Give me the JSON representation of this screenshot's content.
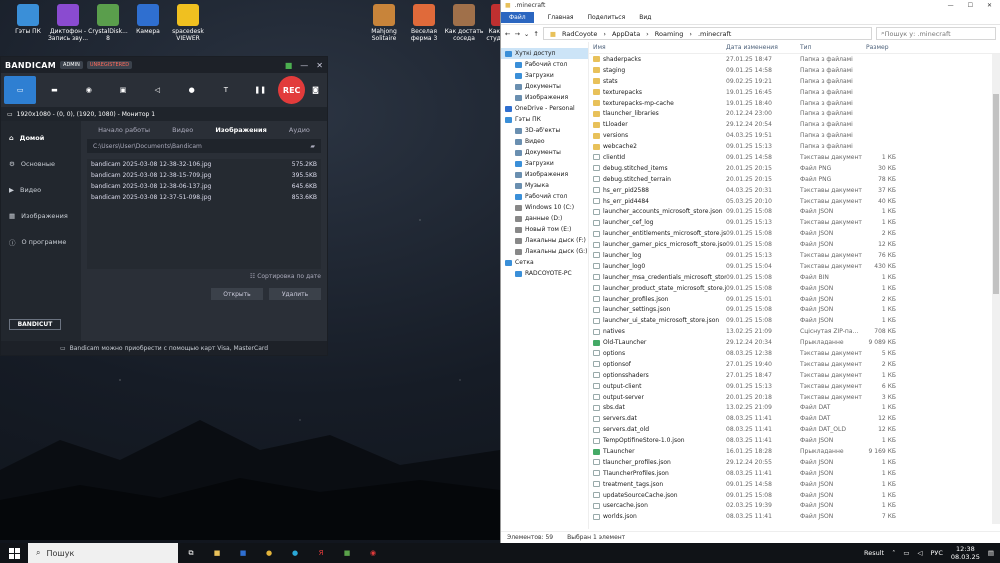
{
  "desktop_icons": [
    {
      "label": "Гэты ПК",
      "color": "#3a8fd8"
    },
    {
      "label": "Диктофон - Запись зву...",
      "color": "#8a4bd0"
    },
    {
      "label": "CrystalDisk... 8",
      "color": "#5a9e4c"
    },
    {
      "label": "Камера",
      "color": "#2f6fd0"
    },
    {
      "label": "spacedesk VIEWER",
      "color": "#f0c020"
    },
    {
      "label": "Mahjong Solitaire",
      "color": "#c8843a"
    },
    {
      "label": "Веселая ферма 3",
      "color": "#e06a3a"
    },
    {
      "label": "Как достать соседа",
      "color": "#a0704a"
    },
    {
      "label": "Как до... студент...",
      "color": "#c03030"
    }
  ],
  "bandicam": {
    "logo": "BANDICAM",
    "badge_admin": "ADMIN",
    "badge_unreg": "UNREGISTERED",
    "rec_label": "REC",
    "info": "1920x1080 - (0, 0), (1920, 1080) - Монитор 1",
    "sidebar": [
      "Домой",
      "Основные",
      "Видео",
      "Изображения",
      "О программе"
    ],
    "tabs": [
      "Начало работы",
      "Видео",
      "Изображения",
      "Аудио"
    ],
    "path": "C:\\Users\\User\\Documents\\Bandicam",
    "files": [
      {
        "name": "bandicam 2025-03-08 12-38-32-106.jpg",
        "size": "575.2KB"
      },
      {
        "name": "bandicam 2025-03-08 12-38-15-709.jpg",
        "size": "395.5KB"
      },
      {
        "name": "bandicam 2025-03-08 12-38-06-137.jpg",
        "size": "645.6KB"
      },
      {
        "name": "bandicam 2025-03-08 12-37-51-098.jpg",
        "size": "853.6KB"
      }
    ],
    "sort_label": "Сортировка по дате",
    "open_btn": "Открыть",
    "delete_btn": "Удалить",
    "bandicut": "BANDICUT",
    "footer": "Bandicam можно приобрести с помощью карт Visa, MasterCard"
  },
  "explorer": {
    "title": ".minecraft",
    "ribbon": [
      "Файл",
      "Главная",
      "Поделиться",
      "Вид"
    ],
    "breadcrumb": [
      "RadCoyote",
      "AppData",
      "Roaming",
      ".minecraft"
    ],
    "search_placeholder": "Пошук у: .minecraft",
    "columns": {
      "name": "Имя",
      "date": "Дата изменения",
      "type": "Тип",
      "size": "Размер"
    },
    "nav": [
      {
        "label": "Хуткі доступ",
        "color": "#3a8fd8",
        "sub": false,
        "sel": true
      },
      {
        "label": "Рабочий стол",
        "color": "#3a8fd8",
        "sub": true
      },
      {
        "label": "Загрузки",
        "color": "#3a8fd8",
        "sub": true
      },
      {
        "label": "Документы",
        "color": "#6a8fb0",
        "sub": true
      },
      {
        "label": "Изображения",
        "color": "#6a8fb0",
        "sub": true
      },
      {
        "label": "OneDrive - Personal",
        "color": "#2f6fd0",
        "sub": false
      },
      {
        "label": "Гэты ПК",
        "color": "#3a8fd8",
        "sub": false
      },
      {
        "label": "3D-аб'екты",
        "color": "#6a8fb0",
        "sub": true
      },
      {
        "label": "Видео",
        "color": "#6a8fb0",
        "sub": true
      },
      {
        "label": "Документы",
        "color": "#6a8fb0",
        "sub": true
      },
      {
        "label": "Загрузки",
        "color": "#3a8fd8",
        "sub": true
      },
      {
        "label": "Изображения",
        "color": "#6a8fb0",
        "sub": true
      },
      {
        "label": "Музыка",
        "color": "#6a8fb0",
        "sub": true
      },
      {
        "label": "Рабочий стол",
        "color": "#3a8fd8",
        "sub": true
      },
      {
        "label": "Windows 10 (C:)",
        "color": "#888",
        "sub": true
      },
      {
        "label": "данные (D:)",
        "color": "#888",
        "sub": true
      },
      {
        "label": "Новый том (E:)",
        "color": "#888",
        "sub": true
      },
      {
        "label": "Лакальны дыск (F:)",
        "color": "#888",
        "sub": true
      },
      {
        "label": "Лакальны дыск (G:)",
        "color": "#888",
        "sub": true
      },
      {
        "label": "Сетка",
        "color": "#3a8fd8",
        "sub": false
      },
      {
        "label": "RADCOYOTE-PC",
        "color": "#3a8fd8",
        "sub": true
      }
    ],
    "rows": [
      {
        "n": "shaderpacks",
        "d": "27.01.25 18:47",
        "t": "Папка з файламі",
        "s": "",
        "k": "folder"
      },
      {
        "n": "staging",
        "d": "09.01.25 14:58",
        "t": "Папка з файламі",
        "s": "",
        "k": "folder"
      },
      {
        "n": "stats",
        "d": "09.02.25 19:21",
        "t": "Папка з файламі",
        "s": "",
        "k": "folder"
      },
      {
        "n": "texturepacks",
        "d": "19.01.25 16:45",
        "t": "Папка з файламі",
        "s": "",
        "k": "folder"
      },
      {
        "n": "texturepacks-mp-cache",
        "d": "19.01.25 18:40",
        "t": "Папка з файламі",
        "s": "",
        "k": "folder"
      },
      {
        "n": "tlauncher_libraries",
        "d": "20.12.24 23:00",
        "t": "Папка з файламі",
        "s": "",
        "k": "folder"
      },
      {
        "n": "tLloader",
        "d": "29.12.24 20:54",
        "t": "Папка з файламі",
        "s": "",
        "k": "folder"
      },
      {
        "n": "versions",
        "d": "04.03.25 19:51",
        "t": "Папка з файламі",
        "s": "",
        "k": "folder"
      },
      {
        "n": "webcache2",
        "d": "09.01.25 15:13",
        "t": "Папка з файламі",
        "s": "",
        "k": "folder"
      },
      {
        "n": "clientId",
        "d": "09.01.25 14:58",
        "t": "Тэкставы дакумент",
        "s": "1 КБ",
        "k": "file"
      },
      {
        "n": "debug.stitched_items",
        "d": "20.01.25 20:15",
        "t": "Файл PNG",
        "s": "30 КБ",
        "k": "file"
      },
      {
        "n": "debug.stitched_terrain",
        "d": "20.01.25 20:15",
        "t": "Файл PNG",
        "s": "78 КБ",
        "k": "file"
      },
      {
        "n": "hs_err_pid2588",
        "d": "04.03.25 20:31",
        "t": "Тэкставы дакумент",
        "s": "37 КБ",
        "k": "file"
      },
      {
        "n": "hs_err_pid4484",
        "d": "05.03.25 20:10",
        "t": "Тэкставы дакумент",
        "s": "40 КБ",
        "k": "file"
      },
      {
        "n": "launcher_accounts_microsoft_store.json",
        "d": "09.01.25 15:08",
        "t": "Файл JSON",
        "s": "1 КБ",
        "k": "file"
      },
      {
        "n": "launcher_cef_log",
        "d": "09.01.25 15:13",
        "t": "Тэкставы дакумент",
        "s": "1 КБ",
        "k": "file"
      },
      {
        "n": "launcher_entitlements_microsoft_store.js...",
        "d": "09.01.25 15:08",
        "t": "Файл JSON",
        "s": "2 КБ",
        "k": "file"
      },
      {
        "n": "launcher_gamer_pics_microsoft_store.json",
        "d": "09.01.25 15:08",
        "t": "Файл JSON",
        "s": "12 КБ",
        "k": "file"
      },
      {
        "n": "launcher_log",
        "d": "09.01.25 15:13",
        "t": "Тэкставы дакумент",
        "s": "76 КБ",
        "k": "file"
      },
      {
        "n": "launcher_log0",
        "d": "09.01.25 15:04",
        "t": "Тэкставы дакумент",
        "s": "430 КБ",
        "k": "file"
      },
      {
        "n": "launcher_msa_credentials_microsoft_stor...",
        "d": "09.01.25 15:08",
        "t": "Файл BIN",
        "s": "1 КБ",
        "k": "file"
      },
      {
        "n": "launcher_product_state_microsoft_store.js...",
        "d": "09.01.25 15:08",
        "t": "Файл JSON",
        "s": "1 КБ",
        "k": "file"
      },
      {
        "n": "launcher_profiles.json",
        "d": "09.01.25 15:01",
        "t": "Файл JSON",
        "s": "2 КБ",
        "k": "file"
      },
      {
        "n": "launcher_settings.json",
        "d": "09.01.25 15:08",
        "t": "Файл JSON",
        "s": "1 КБ",
        "k": "file"
      },
      {
        "n": "launcher_ui_state_microsoft_store.json",
        "d": "09.01.25 15:08",
        "t": "Файл JSON",
        "s": "1 КБ",
        "k": "file"
      },
      {
        "n": "natives",
        "d": "13.02.25 21:09",
        "t": "Сціснутая ZIP-па...",
        "s": "708 КБ",
        "k": "file"
      },
      {
        "n": "Old-TLauncher",
        "d": "29.12.24 20:34",
        "t": "Прыкладанне",
        "s": "9 089 КБ",
        "k": "app"
      },
      {
        "n": "options",
        "d": "08.03.25 12:38",
        "t": "Тэкставы дакумент",
        "s": "5 КБ",
        "k": "file"
      },
      {
        "n": "optionsof",
        "d": "27.01.25 19:40",
        "t": "Тэкставы дакумент",
        "s": "2 КБ",
        "k": "file"
      },
      {
        "n": "optionsshaders",
        "d": "27.01.25 18:47",
        "t": "Тэкставы дакумент",
        "s": "1 КБ",
        "k": "file"
      },
      {
        "n": "output-client",
        "d": "09.01.25 15:13",
        "t": "Тэкставы дакумент",
        "s": "6 КБ",
        "k": "file"
      },
      {
        "n": "output-server",
        "d": "20.01.25 20:18",
        "t": "Тэкставы дакумент",
        "s": "3 КБ",
        "k": "file"
      },
      {
        "n": "sbs.dat",
        "d": "13.02.25 21:09",
        "t": "Файл DAT",
        "s": "1 КБ",
        "k": "file"
      },
      {
        "n": "servers.dat",
        "d": "08.03.25 11:41",
        "t": "Файл DAT",
        "s": "12 КБ",
        "k": "file"
      },
      {
        "n": "servers.dat_old",
        "d": "08.03.25 11:41",
        "t": "Файл DAT_OLD",
        "s": "12 КБ",
        "k": "file"
      },
      {
        "n": "TempOptifineStore-1.0.json",
        "d": "08.03.25 11:41",
        "t": "Файл JSON",
        "s": "1 КБ",
        "k": "file"
      },
      {
        "n": "TLauncher",
        "d": "16.01.25 18:28",
        "t": "Прыкладанне",
        "s": "9 169 КБ",
        "k": "app"
      },
      {
        "n": "tlauncher_profiles.json",
        "d": "29.12.24 20:55",
        "t": "Файл JSON",
        "s": "1 КБ",
        "k": "file"
      },
      {
        "n": "TlauncherProfiles.json",
        "d": "08.03.25 11:41",
        "t": "Файл JSON",
        "s": "1 КБ",
        "k": "file"
      },
      {
        "n": "treatment_tags.json",
        "d": "09.01.25 14:58",
        "t": "Файл JSON",
        "s": "1 КБ",
        "k": "file"
      },
      {
        "n": "updateSourceCache.json",
        "d": "09.01.25 15:08",
        "t": "Файл JSON",
        "s": "1 КБ",
        "k": "file"
      },
      {
        "n": "usercache.json",
        "d": "02.03.25 19:39",
        "t": "Файл JSON",
        "s": "1 КБ",
        "k": "file"
      },
      {
        "n": "worlds.json",
        "d": "08.03.25 11:41",
        "t": "Файл JSON",
        "s": "7 КБ",
        "k": "file"
      }
    ],
    "status_count": "Элементов: 59",
    "status_selected": "Выбран 1 элемент"
  },
  "taskbar": {
    "search_placeholder": "Пошук",
    "weather": "Result",
    "lang": "РУС",
    "time": "12:38",
    "date": "08.03.25"
  }
}
